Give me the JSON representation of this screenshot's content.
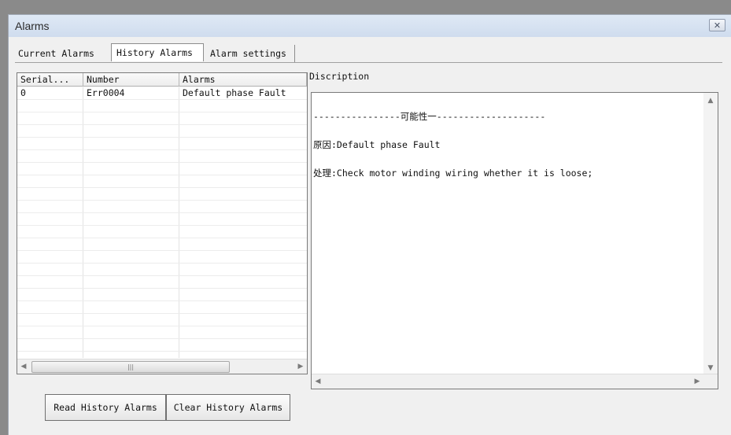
{
  "window": {
    "title": "Alarms",
    "close_icon": "✕"
  },
  "tabs": [
    {
      "label": "Current Alarms",
      "active": false
    },
    {
      "label": "History Alarms",
      "active": true
    },
    {
      "label": "Alarm settings",
      "active": false
    }
  ],
  "table": {
    "columns": [
      "Serial...",
      "Number",
      "Alarms"
    ],
    "rows": [
      [
        "0",
        "Err0004",
        "Default phase Fault"
      ]
    ],
    "empty_row_count": 21
  },
  "description": {
    "label": "Discription",
    "lines": [
      "----------------可能性一--------------------",
      "原因:Default phase Fault",
      "处理:Check motor winding wiring whether it is loose;"
    ]
  },
  "buttons": {
    "read_history": "Read History Alarms",
    "clear_history": "Clear History Alarms"
  }
}
